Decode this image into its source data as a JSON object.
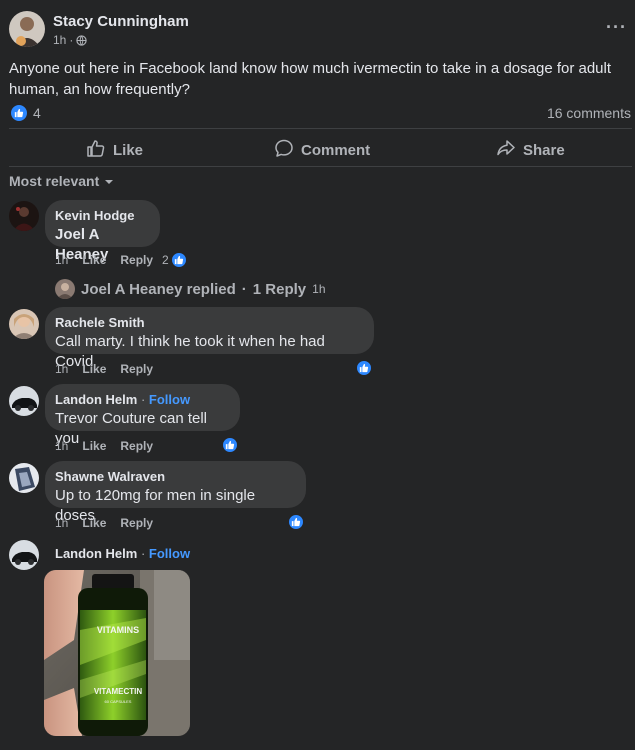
{
  "post": {
    "author": "Stacy Cunningham",
    "time": "1h",
    "text": "Anyone out here in Facebook land know how much ivermectin to take in a dosage for adult human, an how frequently?",
    "reaction_count": "4",
    "comment_count": "16 comments"
  },
  "actions": {
    "like": "Like",
    "comment": "Comment",
    "share": "Share"
  },
  "sort_label": "Most relevant",
  "comments": [
    {
      "name": "Kevin Hodge",
      "text": "Joel A Heaney",
      "time": "1h",
      "like": "Like",
      "reply": "Reply",
      "reactions": "2"
    },
    {
      "name": "Rachele Smith",
      "text": "Call marty. I think he took it when he had Covid",
      "time": "1h",
      "like": "Like",
      "reply": "Reply"
    },
    {
      "name": "Landon Helm",
      "follow": "Follow",
      "text": "Trevor Couture can tell you",
      "time": "1h",
      "like": "Like",
      "reply": "Reply"
    },
    {
      "name": "Shawne Walraven",
      "text": "Up to 120mg for men in single doses",
      "time": "1h",
      "like": "Like",
      "reply": "Reply"
    },
    {
      "name": "Landon Helm",
      "follow": "Follow"
    }
  ],
  "reply_summary": {
    "name": "Joel A Heaney replied",
    "count": "1 Reply",
    "time": "1h"
  },
  "bottle": {
    "brand": "VITAMINS",
    "product": "VITAMECTIN",
    "sub": "60 CAPSULES"
  },
  "colors": {
    "background": "#242526",
    "bubble": "#3a3b3c",
    "accent": "#2d88ff",
    "follow": "#4599ff"
  }
}
